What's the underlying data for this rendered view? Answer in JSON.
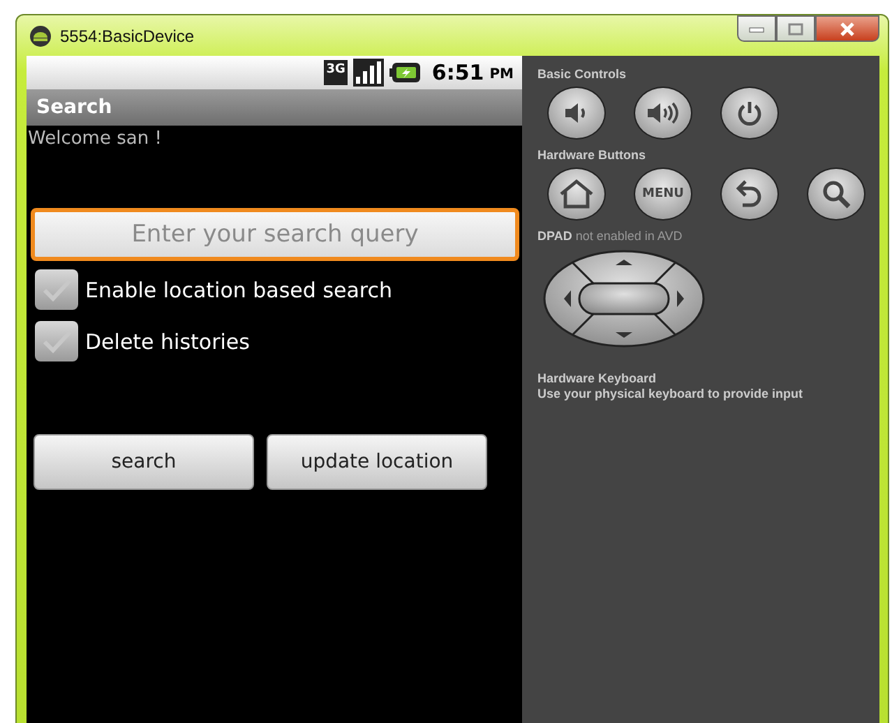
{
  "window": {
    "title": "5554:BasicDevice"
  },
  "status_bar": {
    "network": "3G",
    "time": "6:51",
    "ampm": "PM"
  },
  "app": {
    "title": "Search",
    "welcome": "Welcome san !",
    "search_field": {
      "placeholder": "Enter your search query",
      "focused": true
    },
    "checkboxes": [
      {
        "label": "Enable location based search",
        "checked": false
      },
      {
        "label": "Delete histories",
        "checked": false
      }
    ],
    "buttons": [
      "search",
      "update location"
    ]
  },
  "controls": {
    "basic_controls_label": "Basic Controls",
    "basic_controls": [
      {
        "kind": "volume-down"
      },
      {
        "kind": "volume-up"
      },
      {
        "kind": "power"
      }
    ],
    "hardware_buttons_label": "Hardware Buttons",
    "hardware_buttons": [
      {
        "kind": "home"
      },
      {
        "kind": "menu",
        "label": "MENU"
      },
      {
        "kind": "back"
      },
      {
        "kind": "search"
      }
    ],
    "dpad_label": "**DPAD** not enabled in AVD",
    "keyboard_title": "Hardware Keyboard",
    "keyboard_text": "Use your physical keyboard to provide input"
  }
}
